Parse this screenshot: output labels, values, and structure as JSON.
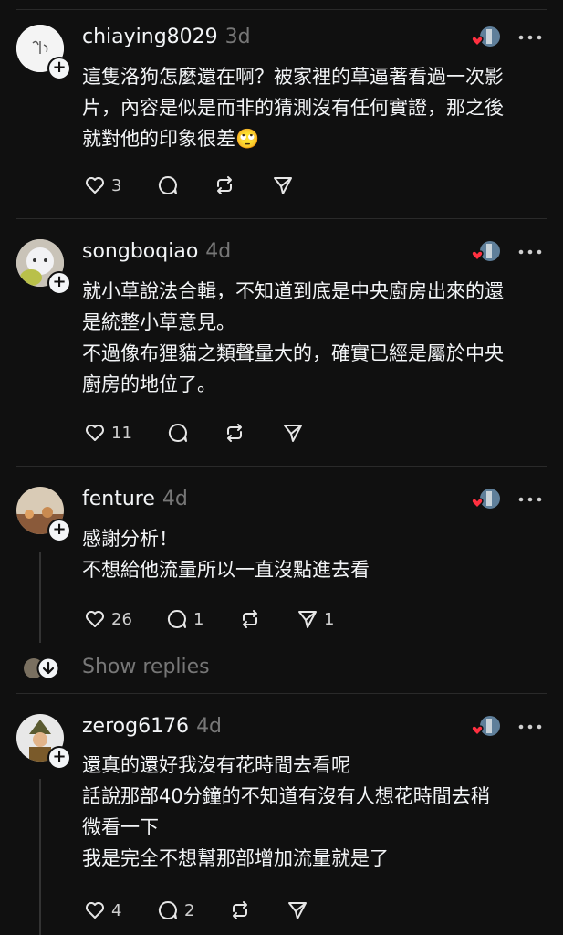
{
  "posts": [
    {
      "username": "chiaying8029",
      "time": "3d",
      "text": "這隻洛狗怎麼還在啊？被家裡的草逼著看過一次影\n片，內容是似是而非的猜測沒有任何實證，那之後\n就對他的印象很差🙄",
      "likes": "3",
      "replies": "",
      "reposts": "",
      "shares": ""
    },
    {
      "username": "songboqiao",
      "time": "4d",
      "text": "就小草說法合輯，不知道到底是中央廚房出來的還\n是統整小草意見。\n不過像布狸貓之類聲量大的，確實已經是屬於中央\n廚房的地位了。",
      "likes": "11",
      "replies": "",
      "reposts": "",
      "shares": ""
    },
    {
      "username": "fenture",
      "time": "4d",
      "text": "感謝分析！\n不想給他流量所以一直沒點進去看",
      "likes": "26",
      "replies": "1",
      "reposts": "",
      "shares": "1"
    },
    {
      "username": "zerog6176",
      "time": "4d",
      "text": "還真的還好我沒有花時間去看呢\n話說那部40分鐘的不知道有沒有人想花時間去稍\n微看一下\n我是完全不想幫那部增加流量就是了",
      "likes": "4",
      "replies": "2",
      "reposts": "",
      "shares": ""
    }
  ],
  "show_replies": "Show replies",
  "colors": {
    "background": "#101010",
    "text": "#f3f5f7",
    "muted": "#777777",
    "heart": "#ff3040"
  },
  "icons": [
    "heart-icon",
    "reply-icon",
    "repost-icon",
    "share-icon",
    "more-icon",
    "plus-icon",
    "liked-by-author-icon"
  ]
}
